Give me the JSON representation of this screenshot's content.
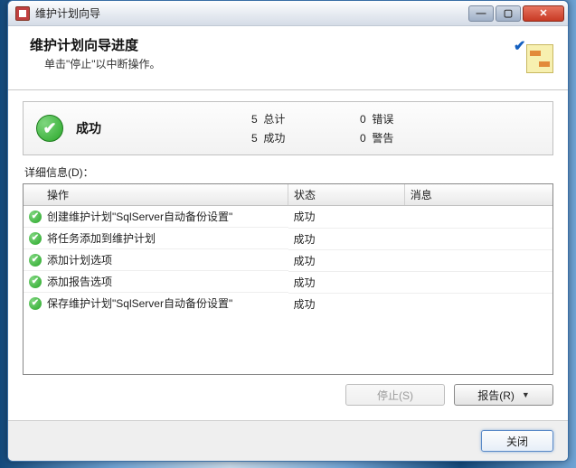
{
  "window": {
    "title": "维护计划向导"
  },
  "header": {
    "title": "维护计划向导进度",
    "subtitle": "单击\"停止\"以中断操作。"
  },
  "summary": {
    "status": "成功",
    "total_count": "5",
    "total_label": "总计",
    "success_count": "5",
    "success_label": "成功",
    "error_count": "0",
    "error_label": "错误",
    "warning_count": "0",
    "warning_label": "警告"
  },
  "details_label": "详细信息(D)：",
  "columns": {
    "operation": "操作",
    "status": "状态",
    "message": "消息"
  },
  "rows": [
    {
      "operation": "创建维护计划\"SqlServer自动备份设置\"",
      "status": "成功",
      "message": ""
    },
    {
      "operation": "将任务添加到维护计划",
      "status": "成功",
      "message": ""
    },
    {
      "operation": "添加计划选项",
      "status": "成功",
      "message": ""
    },
    {
      "operation": "添加报告选项",
      "status": "成功",
      "message": ""
    },
    {
      "operation": "保存维护计划\"SqlServer自动备份设置\"",
      "status": "成功",
      "message": ""
    }
  ],
  "buttons": {
    "stop": "停止(S)",
    "report": "报告(R)",
    "close": "关闭"
  }
}
